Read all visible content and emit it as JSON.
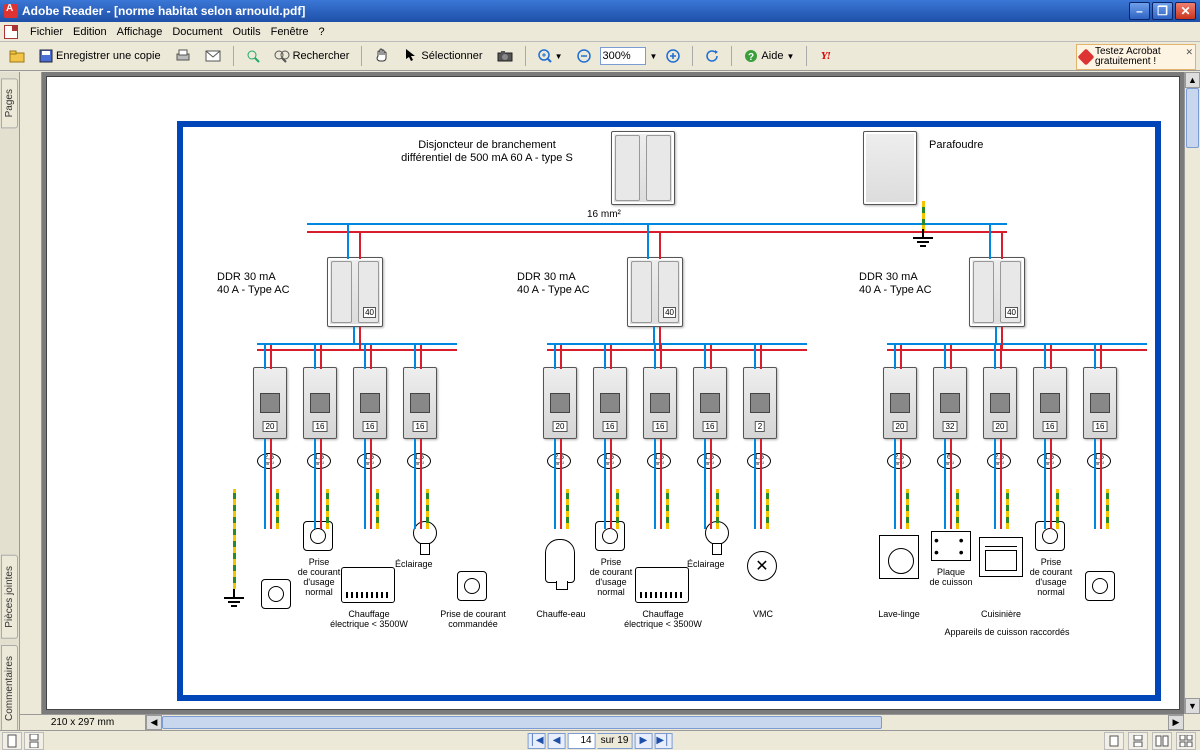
{
  "window": {
    "title": "Adobe Reader - [norme habitat selon arnould.pdf]"
  },
  "menu": {
    "file": "Fichier",
    "edit": "Edition",
    "view": "Affichage",
    "document": "Document",
    "tools": "Outils",
    "window": "Fenêtre",
    "help": "?"
  },
  "toolbar": {
    "save_copy": "Enregistrer une copie",
    "search": "Rechercher",
    "select": "Sélectionner",
    "zoom_value": "300%",
    "help": "Aide",
    "promo_line1": "Testez Acrobat",
    "promo_line2": "gratuitement !"
  },
  "sidetabs": {
    "pages": "Pages",
    "attachments": "Pièces jointes",
    "comments": "Commentaires"
  },
  "nav": {
    "page_field": "14",
    "page_of": "sur 19"
  },
  "status": {
    "page_size": "210 x 297 mm"
  },
  "doc": {
    "main_breaker": "Disjoncteur de branchement\ndifférentiel de 500 mA 60 A - type S",
    "surge": "Parafoudre",
    "trunk_cable": "16 mm²",
    "ddr": {
      "line1": "DDR 30 mA",
      "line2": "40 A - Type AC",
      "amp": "40"
    },
    "breaker_amps_g1": [
      "20",
      "16",
      "16",
      "16"
    ],
    "breaker_amps_g2": [
      "20",
      "16",
      "16",
      "16",
      "2"
    ],
    "breaker_amps_g3": [
      "20",
      "32",
      "20",
      "16",
      "16"
    ],
    "cable_g1": [
      "2,5",
      "1,5",
      "1,5",
      "1,5"
    ],
    "cable_g2": [
      "2,5",
      "1,5",
      "1,5",
      "1,5",
      "1,5"
    ],
    "cable_g3": [
      "2,5",
      "6",
      "2,5",
      "1,5",
      "1,5"
    ],
    "cable_unit": "mm²",
    "loads": {
      "prise_normal": "Prise\nde courant\nd'usage\nnormal",
      "chauffage": "Chauffage\nélectrique < 3500W",
      "eclairage": "Éclairage",
      "prise_cmd": "Prise de courant\ncommandée",
      "chauffe_eau": "Chauffe-eau",
      "vmc": "VMC",
      "lave_linge": "Lave-linge",
      "plaque": "Plaque\nde cuisson",
      "cuisiniere": "Cuisinière",
      "appareils": "Appareils de cuisson raccordés"
    }
  }
}
